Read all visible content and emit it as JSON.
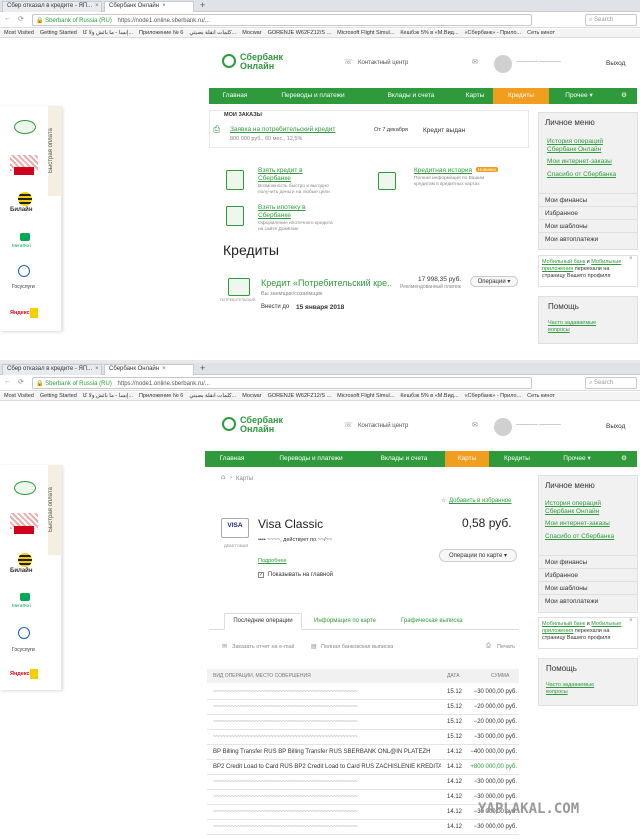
{
  "top": {
    "tabs": [
      "Сбер отказал в кредите - ЯП...",
      "Сбербанк Онлайн"
    ],
    "url_host": "Sberbank of Russia (RU)",
    "url_path": "https://node1.online.sberbank.ru/...",
    "search_placeholder": "Search",
    "bookmarks": [
      "Most Visited",
      "Getting Started",
      "إنسا - ما بائش ولا كا...",
      "Приложение № 6",
      "كلمات انقلة بصيتي...",
      "Мосwar",
      "GORENJE W62FZ12/S ...",
      "Microsoft Flight Simul...",
      "Кешбэк 5% в «М.Вид...",
      "«Сбербанк» - Прило...",
      "Сеть кинот"
    ],
    "logo": "Сбербанк\nОнлайн",
    "logo_line1": "Сбербанк",
    "logo_line2": "Онлайн",
    "contact_center": "Контактный центр",
    "user_name": "~~~~~~ ~~~~~~",
    "logout": "Выход",
    "nav": [
      "Главная",
      "Переводы и платежи",
      "Вклады и счета",
      "Карты",
      "Кредиты",
      "Прочее ▾"
    ],
    "my_orders_label": "МОИ ЗАКАЗЫ",
    "order_title": "Заявка на потребительский кредит",
    "order_desc": "800 000 руб., 60 мес., 12,5%",
    "order_date": "От 7 декабря",
    "order_status": "Кредит выдан",
    "offer1_title": "Взять кредит в Сбербанке",
    "offer1_desc": "Возможность быстро и выгодно получить деньги на любые цели",
    "offer2_title": "Кредитная история",
    "offer2_badge": "Новинка",
    "offer2_desc": "Полная информация по Вашим кредитам в кредитных картах",
    "offer3_title": "Взять ипотеку в Сбербанке",
    "offer3_desc": "Оформление ипотечного кредита на сайте ДомКлик",
    "credits_heading": "Кредиты",
    "credit_name": "Кредит «Потребительский кре...",
    "credit_sub": "Вы заемщик/созаемщик",
    "credit_amount": "17 998,35 руб.",
    "credit_amount_label": "Рекомендованный платеж",
    "credit_pay_by_label": "Внести до",
    "credit_pay_by_date": "15 января 2018",
    "credit_icon_label": "ПОТРЕБИТЕЛЬСКИЙ",
    "operations_btn": "Операции ▾",
    "quickpay_label": "Быстрая оплата",
    "quickpay_items": [
      "Билайн",
      "МегаФон",
      "Госуслуги",
      "Яндекс"
    ],
    "personal_menu_title": "Личное меню",
    "personal_menu_links": [
      "История операций Сбербанк Онлайн",
      "Мои интернет-заказы",
      "Спасибо от Сбербанка"
    ],
    "personal_menu_rows": [
      "Мои финансы",
      "Избранное",
      "Мои шаблоны",
      "Мои автоплатежи"
    ],
    "mobile_notice_part1": "Мобильный банк",
    "mobile_notice_part2": " и ",
    "mobile_notice_part3": "Мобильные приложения",
    "mobile_notice_part4": " переехали на страницу Вашего профиля",
    "help_title": "Помощь",
    "help_link": "Часто задаваемые вопросы"
  },
  "bottom": {
    "breadcrumb": "Карты",
    "add_favorite": "Добавить в избранное",
    "card_brand": "VISA",
    "card_type_label": "ДЕБЕТОВАЯ",
    "card_name": "Visa Classic",
    "card_number": "•••• ~~~~, действует по ~~/~~",
    "card_balance": "0,58 руб.",
    "card_operations_btn": "Операции по карте ▾",
    "details_link": "Подробнее",
    "show_on_main": "Показывать на главной",
    "tabs": [
      "Последние операции",
      "Информация по карте",
      "Графическая выписка"
    ],
    "order_report": "Заказать отчет на e-mail",
    "full_statement": "Полная банковская выписка",
    "print": "Печать",
    "table_header": [
      "ВИД ОПЕРАЦИИ, МЕСТО СОВЕРШЕНИЯ",
      "ДАТА",
      "СУММА"
    ],
    "rows": [
      [
        "~~~~~~~~~~~~~~~~~~~~~~~~~~~~~~~~~~~~~~~~~~~~~~~~",
        "15.12",
        "−30 000,00 руб."
      ],
      [
        "~~~~~~~~~~~~~~~~~~~~~~~~~~~~~~~~~~~~~~~~~~~~~~~~",
        "15.12",
        "−20 000,00 руб."
      ],
      [
        "~~~~~~~~~~~~~~~~~~~~~~~~~~~~~~~~~~~~~~~~~~~~~~~~",
        "15.12",
        "−20 000,00 руб."
      ],
      [
        "~~~~~~~~~~~~~~~~~~~~~~~~~~~~~~~~~~~~~~~~~~~~~~~~",
        "15.12",
        "−30 000,00 руб."
      ],
      [
        "BP Billing Transfer RUS BP Billing Transfer RUS SBERBANK ONL@IN PLATEZH",
        "14.12",
        "−400 000,00 руб."
      ],
      [
        "BP2 Credit Load to Card RUS BP2 Credit Load to Card RUS ZACHISLENIE KREDITA",
        "14.12",
        "+800 000,00 руб."
      ],
      [
        "~~~~~~~~~~~~~~~~~~~~~~~~~~~~~~~~~~~~~~~~~~~~~~~~",
        "14.12",
        "−30 000,00 руб."
      ],
      [
        "~~~~~~~~~~~~~~~~~~~~~~~~~~~~~~~~~~~~~~~~~~~~~~~~",
        "14.12",
        "−30 000,00 руб."
      ],
      [
        "~~~~~~~~~~~~~~~~~~~~~~~~~~~~~~~~~~~~~~~~~~~~~~~~",
        "14.12",
        "−30 000,00 руб."
      ],
      [
        "~~~~~~~~~~~~~~~~~~~~~~~~~~~~~~~~~~~~~~~~~~~~~~~~",
        "14.12",
        "−30 000,00 руб."
      ]
    ],
    "watermark": "YAPLAKAL.COM"
  },
  "colors": {
    "brand_green": "#2f9a3c",
    "accent_orange": "#f19d1e"
  }
}
